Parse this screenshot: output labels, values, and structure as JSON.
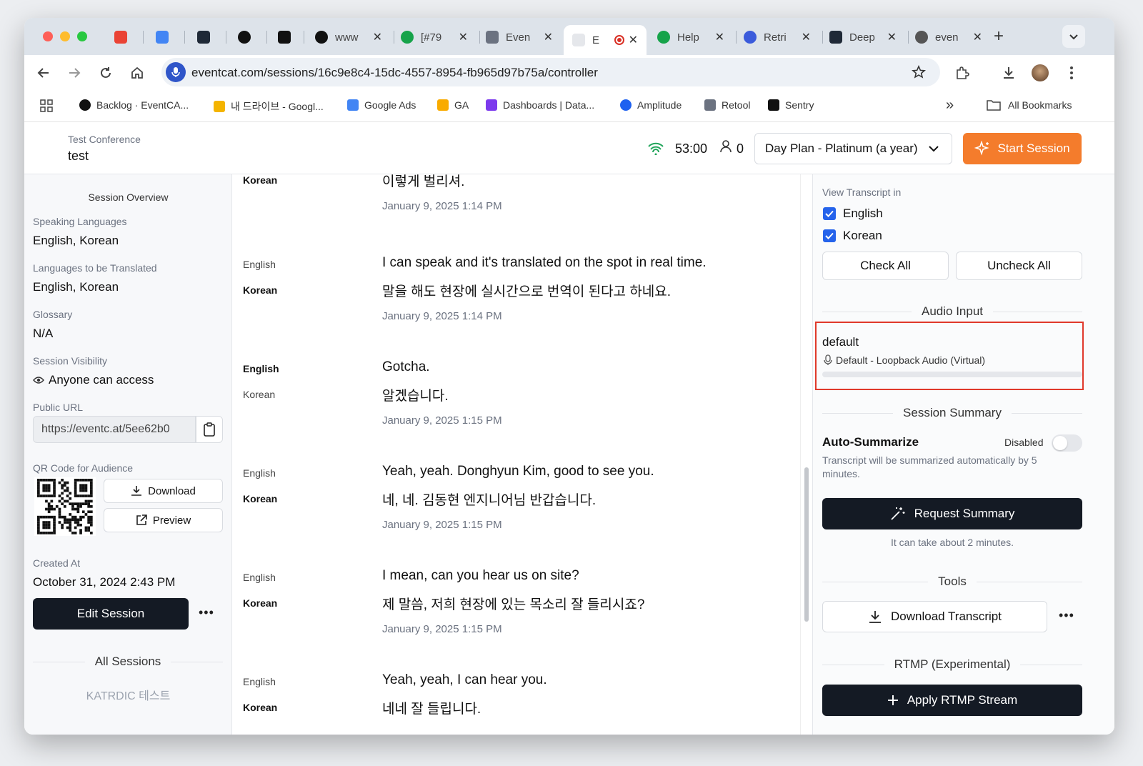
{
  "browser": {
    "tabs": [
      {
        "label": "",
        "icon": "gmail-icon",
        "color": "#ea4335"
      },
      {
        "label": "",
        "icon": "calendar-icon",
        "color": "#4285f4"
      },
      {
        "label": "",
        "icon": "bolt-icon",
        "color": "#1f2937"
      },
      {
        "label": "",
        "icon": "github-icon",
        "color": "#111111"
      },
      {
        "label": "",
        "icon": "notion-icon",
        "color": "#111111"
      },
      {
        "label": "www",
        "icon": "vercel-icon",
        "color": "#111111"
      },
      {
        "label": "[#79",
        "icon": "support-icon",
        "color": "#16a34a"
      },
      {
        "label": "Even",
        "icon": "hierarchy-icon",
        "color": "#6b7280"
      },
      {
        "label": "E",
        "icon": "eventcat-icon",
        "color": "#e5e7eb"
      },
      {
        "label": "Help",
        "icon": "support-icon",
        "color": "#16a34a"
      },
      {
        "label": "Retri",
        "icon": "circle-icon",
        "color": "#3b5bdb"
      },
      {
        "label": "Deep",
        "icon": "hexagon-icon",
        "color": "#1f2937"
      },
      {
        "label": "even",
        "icon": "globe-icon",
        "color": "#555555"
      }
    ],
    "new_tab": "+",
    "url": "eventcat.com/sessions/16c9e8c4-15dc-4557-8954-fb965d97b75a/controller",
    "bookmarks": [
      {
        "label": "Backlog · EventCA...",
        "icon": "github-icon",
        "color": "#111111"
      },
      {
        "label": "내 드라이브 - Googl...",
        "icon": "drive-icon",
        "color": "#f4b400"
      },
      {
        "label": "Google Ads",
        "icon": "ads-icon",
        "color": "#4285f4"
      },
      {
        "label": "GA",
        "icon": "analytics-icon",
        "color": "#f9ab00"
      },
      {
        "label": "Dashboards | Data...",
        "icon": "dashboard-icon",
        "color": "#7c3aed"
      },
      {
        "label": "Amplitude",
        "icon": "amplitude-icon",
        "color": "#1e61f0"
      },
      {
        "label": "Retool",
        "icon": "retool-icon",
        "color": "#6b7280"
      },
      {
        "label": "Sentry",
        "icon": "sentry-icon",
        "color": "#111111"
      }
    ],
    "overflow": "»",
    "all_bookmarks": "All Bookmarks"
  },
  "header": {
    "event_name": "Test Conference",
    "session_name": "test",
    "timer": "53:00",
    "audience_count": "0",
    "plan": "Day Plan - Platinum (a year)",
    "start_label": "Start Session",
    "accent": "#f47c2c",
    "signal_color": "#22a55b"
  },
  "left": {
    "overview_title": "Session Overview",
    "speaking_languages_label": "Speaking Languages",
    "speaking_languages": "English, Korean",
    "translated_label": "Languages to be Translated",
    "translated": "English, Korean",
    "glossary_label": "Glossary",
    "glossary": "N/A",
    "visibility_label": "Session Visibility",
    "visibility": "Anyone can access",
    "public_url_label": "Public URL",
    "public_url": "https://eventc.at/5ee62b0",
    "qr_label": "QR Code for Audience",
    "download_label": "Download",
    "preview_label": "Preview",
    "created_label": "Created At",
    "created": "October 31, 2024 2:43 PM",
    "edit_label": "Edit Session",
    "more": "•••",
    "all_sessions_title": "All Sessions",
    "session_items": [
      "KATRDIC 테스트"
    ]
  },
  "transcript": [
    {
      "lines": [
        {
          "lang": "Korean",
          "bold": true,
          "text": "이렇게 벌리셔."
        }
      ],
      "time": "January 9, 2025 1:14 PM"
    },
    {
      "lines": [
        {
          "lang": "English",
          "bold": false,
          "text": "I can speak and it's translated on the spot in real time."
        },
        {
          "lang": "Korean",
          "bold": true,
          "text": "말을 해도 현장에 실시간으로 번역이 된다고 하네요."
        }
      ],
      "time": "January 9, 2025 1:14 PM"
    },
    {
      "lines": [
        {
          "lang": "English",
          "bold": true,
          "text": "Gotcha."
        },
        {
          "lang": "Korean",
          "bold": false,
          "text": "알겠습니다."
        }
      ],
      "time": "January 9, 2025 1:15 PM"
    },
    {
      "lines": [
        {
          "lang": "English",
          "bold": false,
          "text": "Yeah, yeah. Donghyun Kim, good to see you."
        },
        {
          "lang": "Korean",
          "bold": true,
          "text": "네, 네. 김동현 엔지니어님 반갑습니다."
        }
      ],
      "time": "January 9, 2025 1:15 PM"
    },
    {
      "lines": [
        {
          "lang": "English",
          "bold": false,
          "text": "I mean, can you hear us on site?"
        },
        {
          "lang": "Korean",
          "bold": true,
          "text": "제 말씀, 저희 현장에 있는 목소리 잘 들리시죠?"
        }
      ],
      "time": "January 9, 2025 1:15 PM"
    },
    {
      "lines": [
        {
          "lang": "English",
          "bold": false,
          "text": "Yeah, yeah, I can hear you."
        },
        {
          "lang": "Korean",
          "bold": true,
          "text": "네네 잘 들립니다."
        }
      ],
      "time": ""
    }
  ],
  "right": {
    "view_title": "View Transcript in",
    "languages": [
      {
        "label": "English",
        "checked": true
      },
      {
        "label": "Korean",
        "checked": true
      }
    ],
    "check_all": "Check All",
    "uncheck_all": "Uncheck All",
    "audio_title": "Audio Input",
    "audio_device": "default",
    "audio_source": "Default - Loopback Audio (Virtual)",
    "highlight_color": "#e0392b",
    "summary_title": "Session Summary",
    "auto_label": "Auto-Summarize",
    "auto_state": "Disabled",
    "auto_desc": "Transcript will be summarized automatically by 5 minutes.",
    "request_label": "Request Summary",
    "request_hint": "It can take about 2 minutes.",
    "tools_title": "Tools",
    "download_transcript": "Download Transcript",
    "more": "•••",
    "rtmp_title": "RTMP (Experimental)",
    "apply_rtmp": "Apply RTMP Stream"
  }
}
